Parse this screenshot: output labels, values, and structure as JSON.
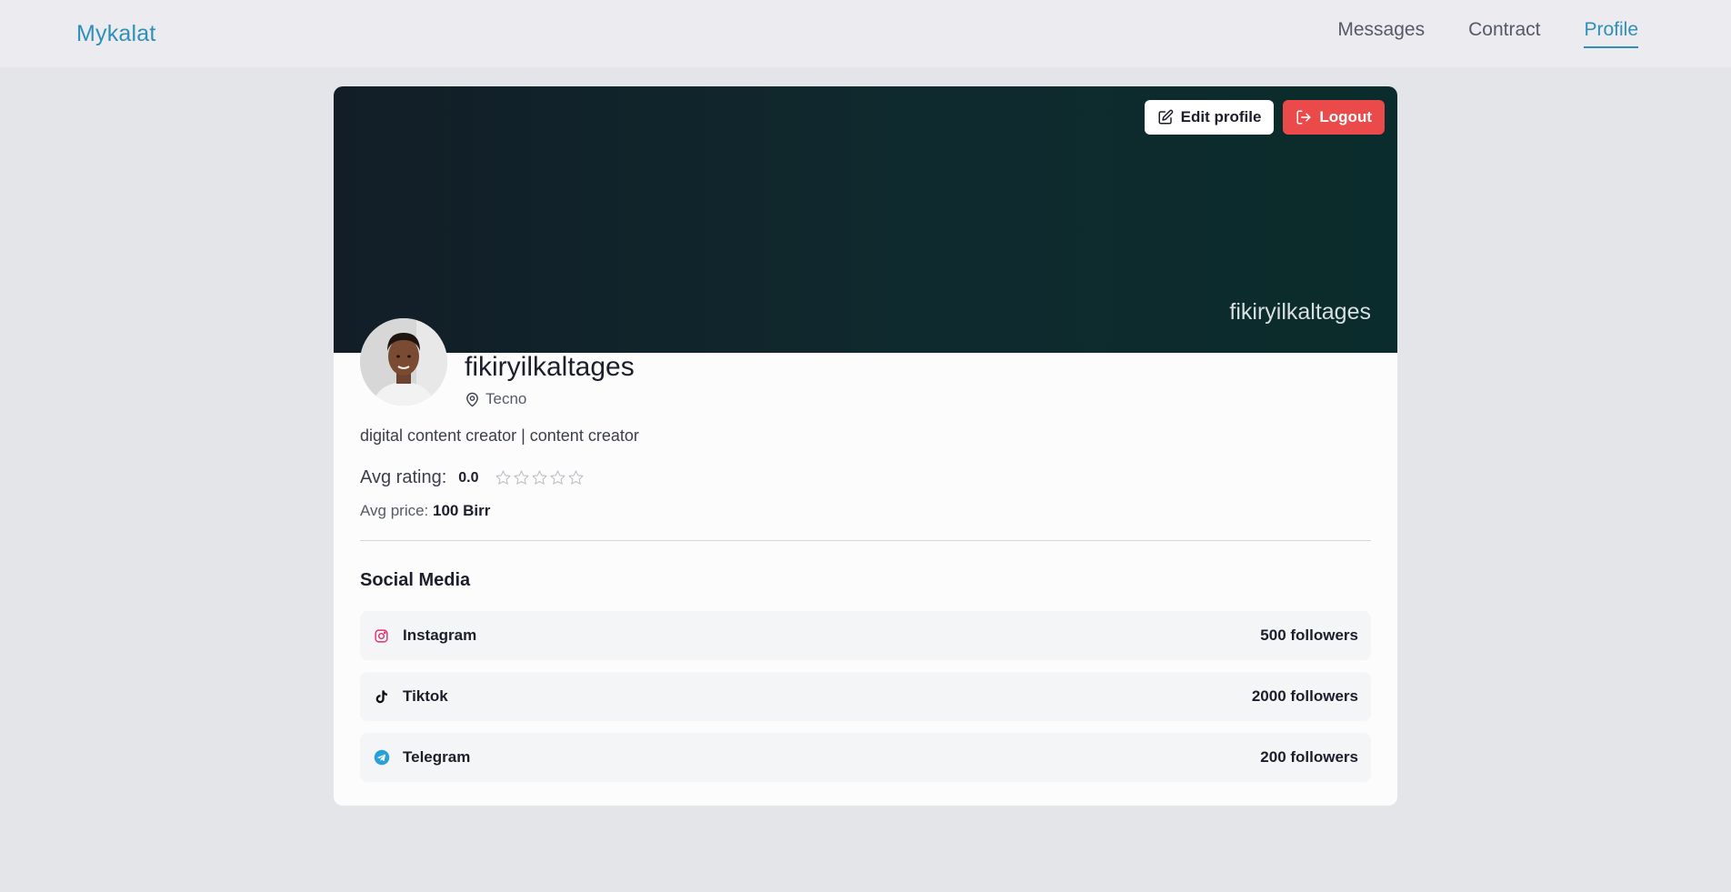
{
  "nav": {
    "brand": "Mykalat",
    "links": [
      {
        "label": "Messages",
        "active": false
      },
      {
        "label": "Contract",
        "active": false
      },
      {
        "label": "Profile",
        "active": true
      }
    ]
  },
  "banner": {
    "username": "fikiryilkaltages",
    "edit_label": "Edit profile",
    "logout_label": "Logout"
  },
  "profile": {
    "name": "fikiryilkaltages",
    "location": "Tecno",
    "bio": "digital content creator | content creator",
    "rating_label": "Avg rating:",
    "rating_value": "0.0",
    "rating_stars": 0,
    "rating_max": 5,
    "price_label": "Avg price:",
    "price_value": "100 Birr"
  },
  "social": {
    "title": "Social Media",
    "items": [
      {
        "name": "Instagram",
        "followers": "500 followers",
        "icon": "instagram-icon",
        "color": "#e1306c"
      },
      {
        "name": "Tiktok",
        "followers": "2000 followers",
        "icon": "tiktok-icon",
        "color": "#111111"
      },
      {
        "name": "Telegram",
        "followers": "200 followers",
        "icon": "telegram-icon",
        "color": "#2aa0d8"
      }
    ]
  },
  "colors": {
    "brand": "#2f8fb8",
    "logout": "#ea4a4a"
  }
}
